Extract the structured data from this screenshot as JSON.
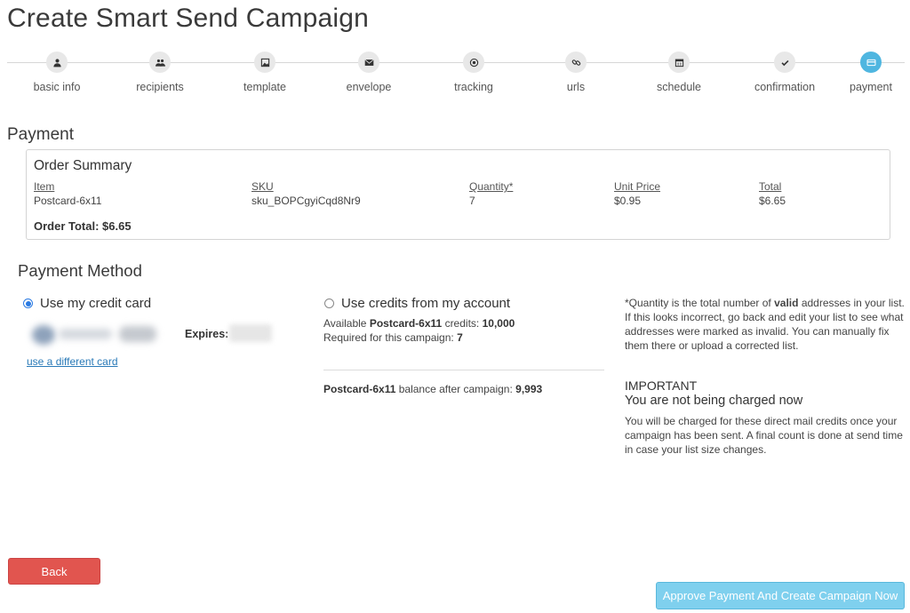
{
  "page": {
    "title": "Create Smart Send Campaign"
  },
  "stepper": {
    "steps": [
      {
        "label": "basic info",
        "icon": "user-icon"
      },
      {
        "label": "recipients",
        "icon": "users-icon"
      },
      {
        "label": "template",
        "icon": "image-icon"
      },
      {
        "label": "envelope",
        "icon": "envelope-icon"
      },
      {
        "label": "tracking",
        "icon": "target-icon"
      },
      {
        "label": "urls",
        "icon": "link-icon"
      },
      {
        "label": "schedule",
        "icon": "calendar-icon"
      },
      {
        "label": "confirmation",
        "icon": "check-icon"
      },
      {
        "label": "payment",
        "icon": "credit-card-icon"
      }
    ],
    "active_step": "payment",
    "active_color": "#4fb6e0"
  },
  "payment": {
    "title": "Payment",
    "order_summary": {
      "title": "Order Summary",
      "columns": [
        "Item",
        "SKU",
        "Quantity*",
        "Unit Price",
        "Total"
      ],
      "row": [
        "Postcard-6x11",
        "sku_BOPCgyiCqd8Nr9",
        "7",
        "$0.95",
        "$6.65"
      ],
      "order_total_label": "Order Total: $6.65"
    }
  },
  "payment_method": {
    "title": "Payment Method",
    "credit_card": {
      "label": "Use my credit card",
      "selected": true,
      "expires_label": "Expires:",
      "different_card_link": "use a different card"
    },
    "credits": {
      "label": "Use credits from my account",
      "selected": false,
      "available_prefix": "Available",
      "product": "Postcard-6x11",
      "available_mid": "credits:",
      "available_value": "10,000",
      "required_prefix": "Required for this campaign:",
      "required_value": "7",
      "balance_product": "Postcard-6x11",
      "balance_label": "balance after campaign:",
      "balance_value": "9,993"
    },
    "note": {
      "part1": "*Quantity is the total number of",
      "bold": "valid",
      "part2": "addresses in your list. If this looks incorrect, go back and edit your list to see what addresses were marked as invalid. You can manually fix them there or upload a corrected list."
    },
    "important": {
      "heading": "IMPORTANT",
      "subheading": "You are not being charged now",
      "text": "You will be charged for these direct mail credits once your campaign has been sent. A final count is done at send time in case your list size changes."
    }
  },
  "buttons": {
    "back": "Back",
    "back_color": "#e1554f",
    "approve": "Approve Payment And Create Campaign Now",
    "approve_color": "#7fd0ee"
  }
}
